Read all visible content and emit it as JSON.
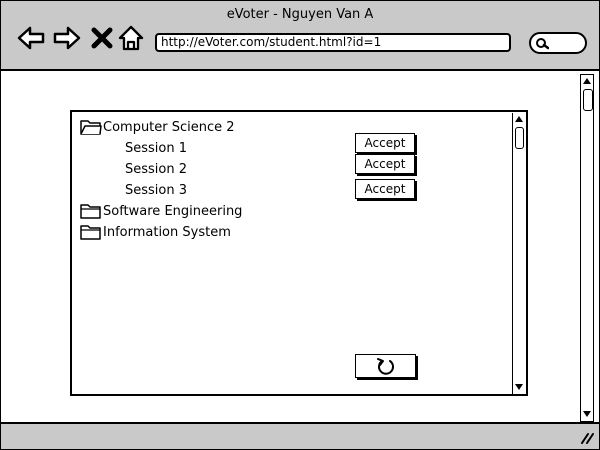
{
  "window": {
    "title": "eVoter - Nguyen Van A"
  },
  "navbar": {
    "back_icon": "arrow-left-icon",
    "forward_icon": "arrow-right-icon",
    "stop_icon": "close-icon",
    "home_icon": "home-icon",
    "url": "http://eVoter.com/student.html?id=1",
    "search_icon": "search-icon"
  },
  "tree": {
    "items": [
      {
        "label": "Computer Science 2",
        "type": "folder",
        "expanded": true,
        "children": [
          {
            "label": "Session 1",
            "action": "Accept"
          },
          {
            "label": "Session 2",
            "action": "Accept"
          },
          {
            "label": "Session 3",
            "action": "Accept"
          }
        ]
      },
      {
        "label": "Software Engineering",
        "type": "folder"
      },
      {
        "label": "Information System",
        "type": "folder"
      }
    ]
  },
  "refresh_icon": "refresh-icon"
}
